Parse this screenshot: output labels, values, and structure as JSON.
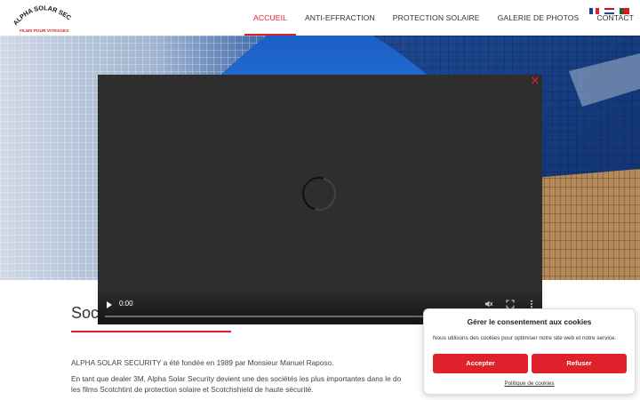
{
  "logo": {
    "name": "ALPHA SOLAR SECURITY",
    "tagline": "FILMS POUR VITRAGES"
  },
  "nav": [
    {
      "label": "ACCUEIL",
      "active": true
    },
    {
      "label": "ANTI-EFFRACTION"
    },
    {
      "label": "PROTECTION SOLAIRE"
    },
    {
      "label": "GALERIE DE PHOTOS"
    },
    {
      "label": "CONTACT"
    }
  ],
  "flags": [
    "fr",
    "nl",
    "pt"
  ],
  "video": {
    "time": "0:00",
    "close_icon": "close-icon"
  },
  "section": {
    "title": "Soci",
    "paragraphs": [
      "ALPHA SOLAR SECURITY a été fondée en 1989 par Monsieur Manuel Raposo.",
      "En tant que dealer 3M, Alpha Solar Security devient une des sociétés les plus importantes dans le do",
      "les films Scotchtint de protection solaire et Scotchshield de haute sécurité."
    ]
  },
  "cookie": {
    "title": "Gérer le consentement aux cookies",
    "text": "Nous utilisons des cookies pour optimiser notre site web et notre service.",
    "accept": "Accepter",
    "refuse": "Refuser",
    "policy": "Politique de cookies"
  },
  "colors": {
    "accent": "#e0202a",
    "video_bg": "#2e2e2e"
  }
}
